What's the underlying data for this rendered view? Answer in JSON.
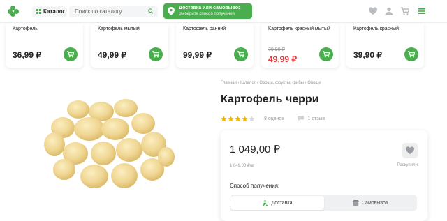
{
  "header": {
    "catalog_label": "Каталог",
    "search_placeholder": "Поиск по каталогу",
    "delivery_title": "Доставка или самовывоз",
    "delivery_subtitle": "Выберите способ получения"
  },
  "products": [
    {
      "name": "Картофель",
      "price": "36,99 ₽",
      "old_price": ""
    },
    {
      "name": "Картофель мытый",
      "price": "49,99 ₽",
      "old_price": ""
    },
    {
      "name": "Картофель ранний",
      "price": "99,99 ₽",
      "old_price": ""
    },
    {
      "name": "Картофель красный мытый",
      "price": "49,99 ₽",
      "old_price": "79,90 ₽"
    },
    {
      "name": "Картофель красный",
      "price": "39,90 ₽",
      "old_price": ""
    }
  ],
  "breadcrumb": "Главная  ›  Каталог  ›  Овощи, фрукты, грибы  ›  Овощи",
  "product": {
    "title": "Картофель черри",
    "rating_count": "8 оценок",
    "reviews_count": "1 отзыв",
    "price": "1 049,00 ₽",
    "price_per_kg": "1 049,00 ₽/кг",
    "favorite_label": "Раскупили",
    "method_label": "Способ получения:",
    "delivery_option": "Доставка",
    "pickup_option": "Самовывоз",
    "rating_stars": 4
  },
  "colors": {
    "accent": "#4aae4f",
    "sale": "#e7363e",
    "star": "#f5b301"
  }
}
